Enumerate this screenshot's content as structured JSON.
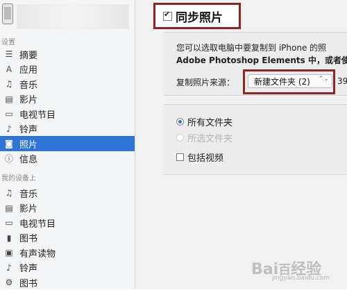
{
  "sidebar": {
    "section_settings": "设置",
    "settings_items": [
      {
        "label": "摘要",
        "icon": "summary-icon",
        "glyph": "☰"
      },
      {
        "label": "应用",
        "icon": "apps-icon",
        "glyph": "A"
      },
      {
        "label": "音乐",
        "icon": "music-icon",
        "glyph": "♫"
      },
      {
        "label": "影片",
        "icon": "movies-icon",
        "glyph": "▤"
      },
      {
        "label": "电视节目",
        "icon": "tv-icon",
        "glyph": "▭"
      },
      {
        "label": "铃声",
        "icon": "bell-icon",
        "glyph": "♪"
      },
      {
        "label": "照片",
        "icon": "camera-icon",
        "glyph": "◙",
        "active": true
      },
      {
        "label": "信息",
        "icon": "info-icon",
        "glyph": "ⓘ"
      }
    ],
    "section_on_device": "我的设备上",
    "device_items": [
      {
        "label": "音乐",
        "icon": "music-icon",
        "glyph": "♫"
      },
      {
        "label": "影片",
        "icon": "movies-icon",
        "glyph": "▤"
      },
      {
        "label": "电视节目",
        "icon": "tv-icon",
        "glyph": "▭"
      },
      {
        "label": "图书",
        "icon": "book-icon",
        "glyph": "▮"
      },
      {
        "label": "有声读物",
        "icon": "audiobook-icon",
        "glyph": "▣"
      },
      {
        "label": "铃声",
        "icon": "bell-icon",
        "glyph": "♪"
      },
      {
        "label": "图书",
        "icon": "gear-icon",
        "glyph": "⚙"
      }
    ]
  },
  "photos": {
    "sync_label": "同步照片",
    "description_line1": "您可以选取电脑中要复制到 iPhone 的照",
    "description_line2": "Adobe Photoshop Elements 中，或者使",
    "copy_source_label": "复制照片来源：",
    "copy_source_value": "新建文件夹 (2)",
    "photo_count": "39",
    "options": [
      {
        "label": "所有文件夹",
        "selected": true,
        "enabled": true
      },
      {
        "label": "所选文件夹",
        "selected": false,
        "enabled": false
      }
    ],
    "include_videos_label": "包括视频"
  },
  "colors": {
    "accent": "#2f75d6",
    "highlight_border": "#8b2424"
  },
  "watermark": {
    "text": "Bai百经验",
    "sub": "jingyan.baidu.com"
  }
}
